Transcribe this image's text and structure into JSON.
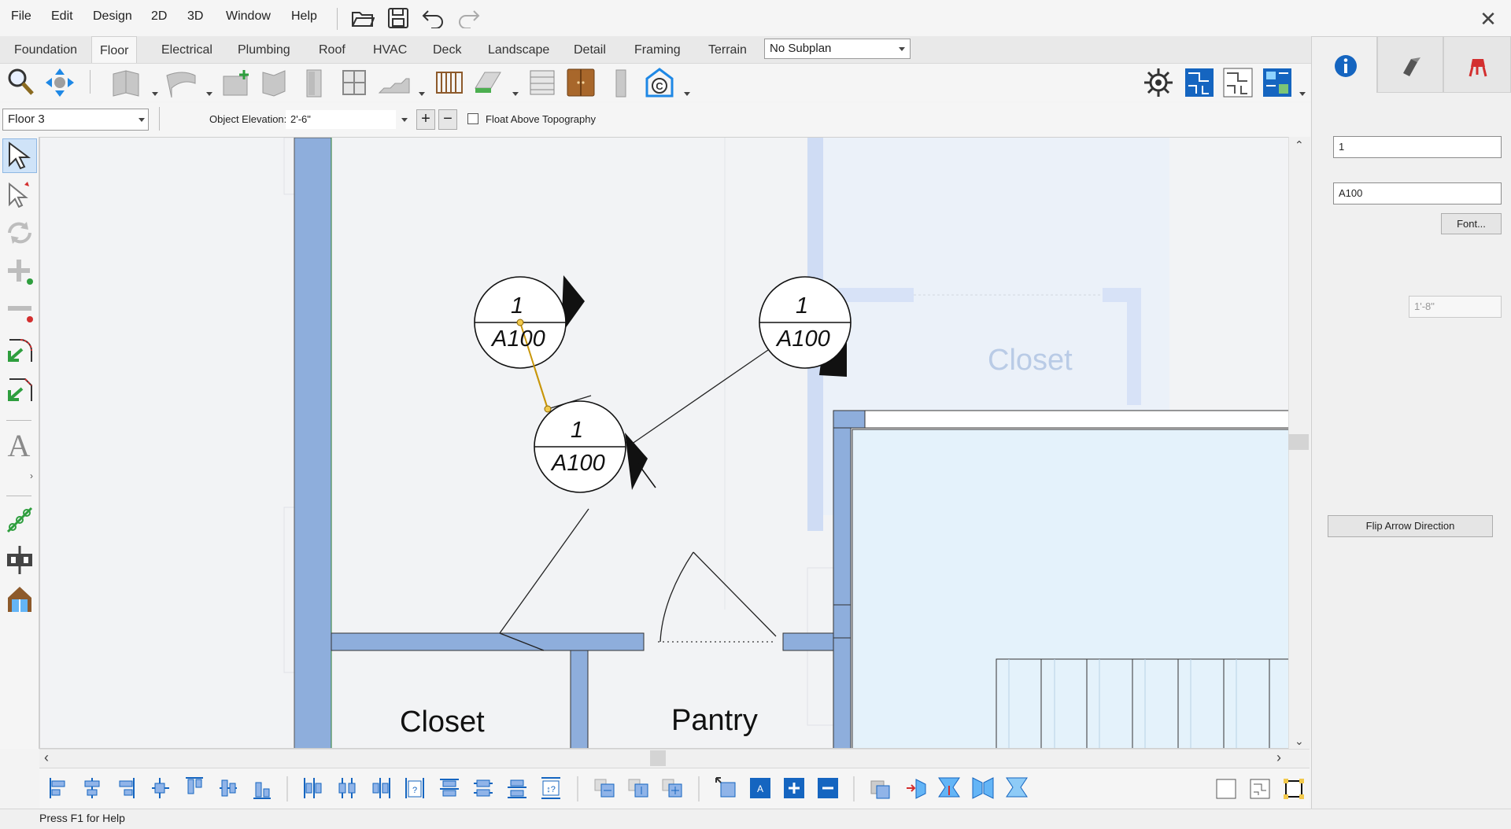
{
  "menu": {
    "items": [
      "File",
      "Edit",
      "Design",
      "2D",
      "3D",
      "Window",
      "Help"
    ]
  },
  "window": {
    "close_glyph": "✕"
  },
  "tabs": [
    {
      "label": "Foundation"
    },
    {
      "label": "Floor"
    },
    {
      "label": "Electrical"
    },
    {
      "label": "Plumbing"
    },
    {
      "label": "Roof"
    },
    {
      "label": "HVAC"
    },
    {
      "label": "Deck"
    },
    {
      "label": "Landscape"
    },
    {
      "label": "Detail"
    },
    {
      "label": "Framing"
    },
    {
      "label": "Terrain"
    }
  ],
  "active_tab": "Floor",
  "subplan": {
    "value": "No Subplan"
  },
  "floor_row": {
    "floor_select": "Floor 3",
    "elevation_label": "Object Elevation:",
    "elevation_value": "2'-6\"",
    "plus": "+",
    "minus": "−",
    "float_label": "Float Above Topography",
    "float_checked": false
  },
  "canvas": {
    "markers": [
      {
        "top": "1",
        "bottom": "A100"
      },
      {
        "top": "1",
        "bottom": "A100"
      },
      {
        "top": "1",
        "bottom": "A100"
      }
    ],
    "room_labels": {
      "closet_faded": "Closet",
      "closet": "Closet",
      "pantry": "Pantry"
    }
  },
  "right_panel": {
    "field_1": "1",
    "field_2": "A100",
    "font_button": "Font...",
    "size_field": "1'-8\"",
    "flip_button": "Flip Arrow Direction"
  },
  "status": {
    "help_text": "Press F1 for Help"
  },
  "colors": {
    "wall_fill": "#8eaedc",
    "room_fill": "#e6f2fb",
    "selection": "#c8960a",
    "accent_blue": "#1565c0"
  }
}
